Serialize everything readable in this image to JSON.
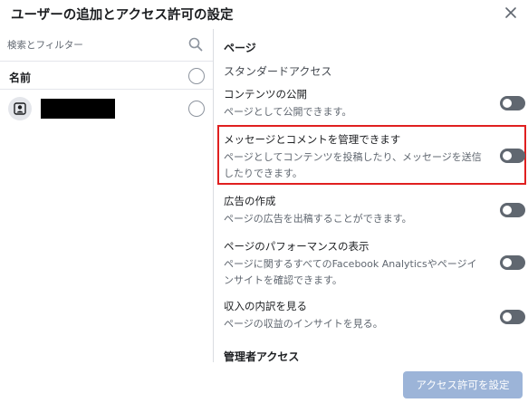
{
  "dialog": {
    "title": "ユーザーの追加とアクセス許可の設定",
    "close_icon": "close-icon"
  },
  "left": {
    "search_placeholder": "検索とフィルター",
    "search_icon": "search-icon",
    "name_header": "名前",
    "user_avatar_icon": "person-icon"
  },
  "right": {
    "page_section": "ページ",
    "standard_access": "スタンダードアクセス",
    "permissions": [
      {
        "title": "コンテンツの公開",
        "desc": "ページとして公開できます。",
        "enabled": false
      },
      {
        "title": "メッセージとコメントを管理できます",
        "desc": "ページとしてコンテンツを投稿したり、メッセージを送信したりできます。",
        "enabled": false
      },
      {
        "title": "広告の作成",
        "desc": "ページの広告を出稿することができます。",
        "enabled": false
      },
      {
        "title": "ページのパフォーマンスの表示",
        "desc": "ページに関するすべてのFacebook Analyticsやページインサイトを確認できます。",
        "enabled": false
      },
      {
        "title": "収入の内訳を見る",
        "desc": "ページの収益のインサイトを見る。",
        "enabled": false
      }
    ],
    "admin_access": "管理者アクセス"
  },
  "footer": {
    "submit_label": "アクセス許可を設定"
  },
  "colors": {
    "highlight": "#e02020",
    "toggle_off": "#606770",
    "button_disabled": "#9cb4d8"
  }
}
